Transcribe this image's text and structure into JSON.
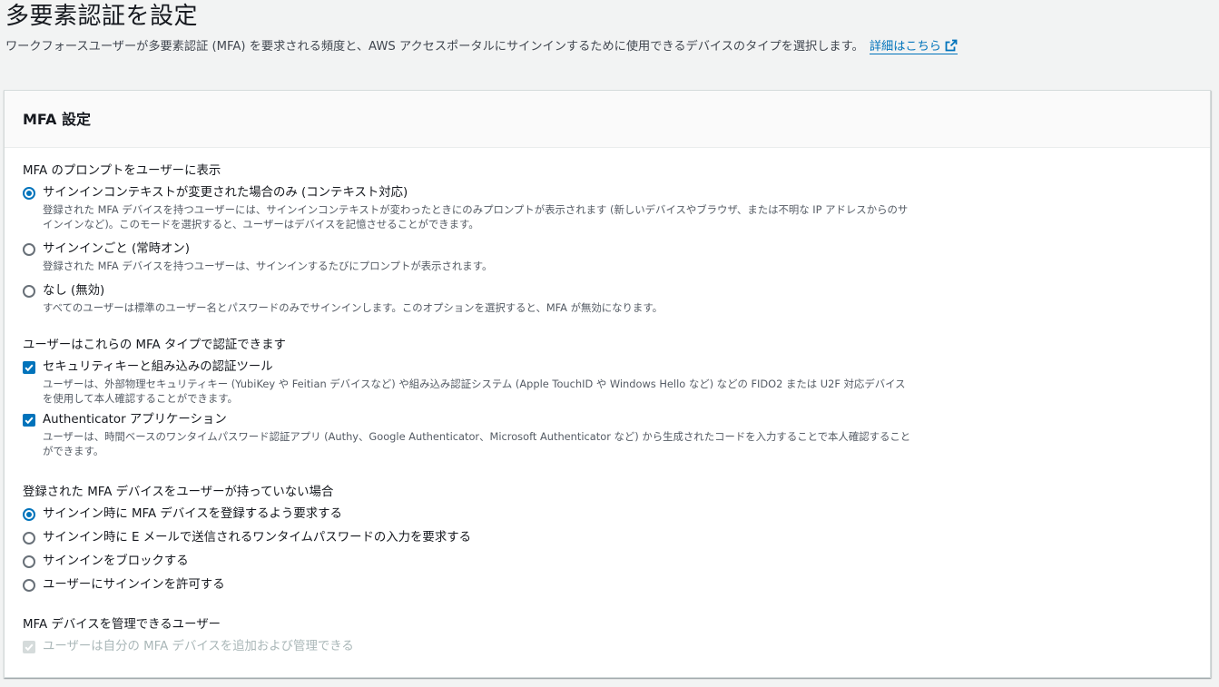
{
  "header": {
    "title": "多要素認証を設定",
    "description": "ワークフォースユーザーが多要素認証 (MFA) を要求される頻度と、AWS アクセスポータルにサインインするために使用できるデバイスのタイプを選択します。",
    "learn_more": "詳細はこちら",
    "external_icon": "external-link-icon"
  },
  "panel": {
    "title": "MFA 設定",
    "prompt_group": {
      "label": "MFA のプロンプトをユーザーに表示",
      "options": [
        {
          "label": "サインインコンテキストが変更された場合のみ (コンテキスト対応)",
          "description": "登録された MFA デバイスを持つユーザーには、サインインコンテキストが変わったときにのみプロンプトが表示されます (新しいデバイスやブラウザ、または不明な IP アドレスからのサインインなど)。このモードを選択すると、ユーザーはデバイスを記憶させることができます。",
          "selected": true
        },
        {
          "label": "サインインごと (常時オン)",
          "description": "登録された MFA デバイスを持つユーザーは、サインインするたびにプロンプトが表示されます。",
          "selected": false
        },
        {
          "label": "なし (無効)",
          "description": "すべてのユーザーは標準のユーザー名とパスワードのみでサインインします。このオプションを選択すると、MFA が無効になります。",
          "selected": false
        }
      ]
    },
    "types_group": {
      "label": "ユーザーはこれらの MFA タイプで認証できます",
      "options": [
        {
          "label": "セキュリティキーと組み込みの認証ツール",
          "description": "ユーザーは、外部物理セキュリティキー (YubiKey や Feitian デバイスなど) や組み込み認証システム (Apple TouchID や Windows Hello など) などの FIDO2 または U2F 対応デバイスを使用して本人確認することができます。",
          "checked": true
        },
        {
          "label": "Authenticator アプリケーション",
          "description": "ユーザーは、時間ベースのワンタイムパスワード認証アプリ (Authy、Google Authenticator、Microsoft Authenticator など) から生成されたコードを入力することで本人確認することができます。",
          "checked": true
        }
      ]
    },
    "no_device_group": {
      "label": "登録された MFA デバイスをユーザーが持っていない場合",
      "options": [
        {
          "label": "サインイン時に MFA デバイスを登録するよう要求する",
          "selected": true
        },
        {
          "label": "サインイン時に E メールで送信されるワンタイムパスワードの入力を要求する",
          "selected": false
        },
        {
          "label": "サインインをブロックする",
          "selected": false
        },
        {
          "label": "ユーザーにサインインを許可する",
          "selected": false
        }
      ]
    },
    "manage_group": {
      "label": "MFA デバイスを管理できるユーザー",
      "options": [
        {
          "label": "ユーザーは自分の MFA デバイスを追加および管理できる",
          "checked": true,
          "disabled": true
        }
      ]
    }
  },
  "colors": {
    "accent": "#0073bb",
    "background": "#f2f3f3",
    "panel": "#ffffff",
    "disabled": "#aab7b8"
  }
}
